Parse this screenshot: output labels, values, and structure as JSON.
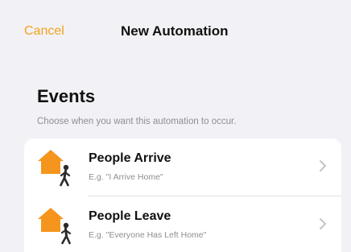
{
  "nav": {
    "cancel_label": "Cancel",
    "title": "New Automation"
  },
  "colors": {
    "accent": "#f3a21b",
    "background": "#f2f2f6",
    "card": "#ffffff",
    "secondary_text": "#8e8e93"
  },
  "section": {
    "title": "Events",
    "subtitle": "Choose when you want this automation to occur."
  },
  "events": [
    {
      "title": "People Arrive",
      "subtitle": "E.g. \"I Arrive Home\"",
      "icon": "house-person-arrive-icon"
    },
    {
      "title": "People Leave",
      "subtitle": "E.g. \"Everyone Has Left Home\"",
      "icon": "house-person-leave-icon"
    }
  ]
}
